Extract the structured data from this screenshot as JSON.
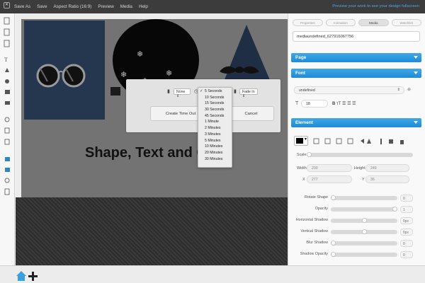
{
  "app": {
    "menu": [
      "Save As",
      "Save",
      "Aspect Ratio (16:9)",
      "Preview",
      "Media",
      "Help"
    ],
    "preview_hint": "Preview your work to see your design fullscreen",
    "close_glyph": "✕"
  },
  "canvas": {
    "headline": "Shape, Text and G"
  },
  "dialog": {
    "transition_in_select": "None",
    "fade_select": "Fade In",
    "create_button": "Create Time Out",
    "cancel_button": "Cancel",
    "duration_options": [
      "5 Seconds",
      "10 Seconds",
      "15 Seconds",
      "30 Seconds",
      "45 Seconds",
      "1 Minute",
      "2 Minutes",
      "3 Minutes",
      "5 Minutes",
      "10 Minutes",
      "20 Minutes",
      "30 Minutes"
    ],
    "selected_index": 0
  },
  "panel": {
    "tabs": [
      "Properties",
      "Animation",
      "Media",
      "Watchlist"
    ],
    "active_tab_index": 2,
    "filename": "mediaundefined_627916067756",
    "sections": {
      "page": "Page",
      "font": "Font",
      "element": "Element"
    },
    "font": {
      "family": "undefined",
      "size": "18"
    },
    "element": {
      "scale_label": "Scale",
      "width_label": "Width",
      "width_value": "200",
      "height_label": "Height",
      "height_value": "249",
      "x_label": "X",
      "x_value": "277",
      "y_label": "Y",
      "y_value": "36"
    },
    "sliders": [
      {
        "label": "Rotate Shape",
        "value": "0",
        "fraction": 0.0
      },
      {
        "label": "Opacity",
        "value": "1",
        "fraction": 1.0
      },
      {
        "label": "Horizontal Shadow",
        "value": "0px",
        "fraction": 0.5
      },
      {
        "label": "Vertical Shadow",
        "value": "0px",
        "fraction": 0.5
      },
      {
        "label": "Blur Shadow",
        "value": "0",
        "fraction": 0.0
      },
      {
        "label": "Shadow Opacity",
        "value": "0",
        "fraction": 0.0
      }
    ]
  },
  "colors": {
    "accent": "#1e8ad8",
    "menubar": "#3c3c3c",
    "dim_overlay": "#737373",
    "home_icon": "#3aa0e0"
  }
}
